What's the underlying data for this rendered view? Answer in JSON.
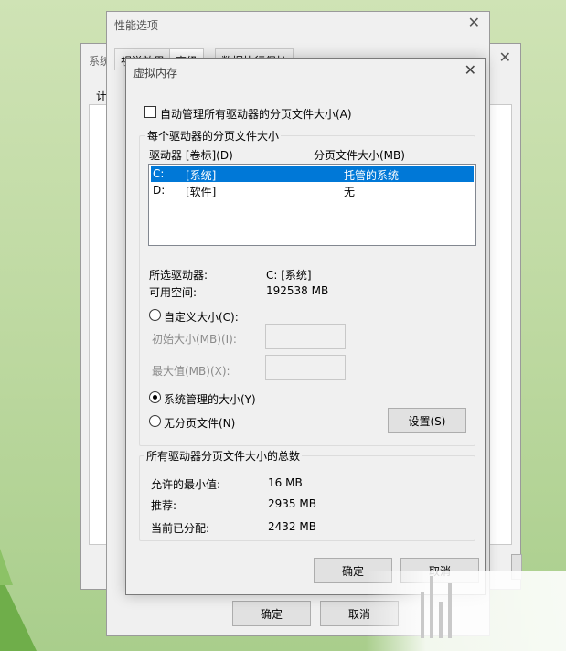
{
  "back_window": {
    "title": "系统",
    "tab_partial": "计",
    "close_glyph": "✕"
  },
  "perf_window": {
    "title": "性能选项",
    "close_glyph": "✕",
    "tabs": [
      "视觉效果",
      "高级",
      "数据执行保护"
    ],
    "ok_label": "确定",
    "cancel_label": "取消"
  },
  "vm_window": {
    "title": "虚拟内存",
    "close_glyph": "✕",
    "auto_manage_label": "自动管理所有驱动器的分页文件大小(A)",
    "auto_manage_checked": false,
    "per_drive_group": "每个驱动器的分页文件大小",
    "col_drive": "驱动器 [卷标](D)",
    "col_size": "分页文件大小(MB)",
    "drives": [
      {
        "letter": "C:",
        "label": "[系统]",
        "size": "托管的系统",
        "selected": true
      },
      {
        "letter": "D:",
        "label": "[软件]",
        "size": "无",
        "selected": false
      }
    ],
    "selected_drive_label": "所选驱动器:",
    "selected_drive_value": "C:  [系统]",
    "free_space_label": "可用空间:",
    "free_space_value": "192538 MB",
    "custom_size_label": "自定义大小(C):",
    "initial_size_label": "初始大小(MB)(I):",
    "max_size_label": "最大值(MB)(X):",
    "system_managed_label": "系统管理的大小(Y)",
    "no_paging_label": "无分页文件(N)",
    "set_button": "设置(S)",
    "selected_option": "system_managed",
    "total_group": "所有驱动器分页文件大小的总数",
    "min_allowed_label": "允许的最小值:",
    "min_allowed_value": "16 MB",
    "recommended_label": "推荐:",
    "recommended_value": "2935 MB",
    "current_label": "当前已分配:",
    "current_value": "2432 MB",
    "ok_label": "确定",
    "cancel_label": "取消"
  },
  "colors": {
    "selection": "#0078d7",
    "window_bg": "#f0f0f0",
    "desktop": "#bcd89f"
  }
}
